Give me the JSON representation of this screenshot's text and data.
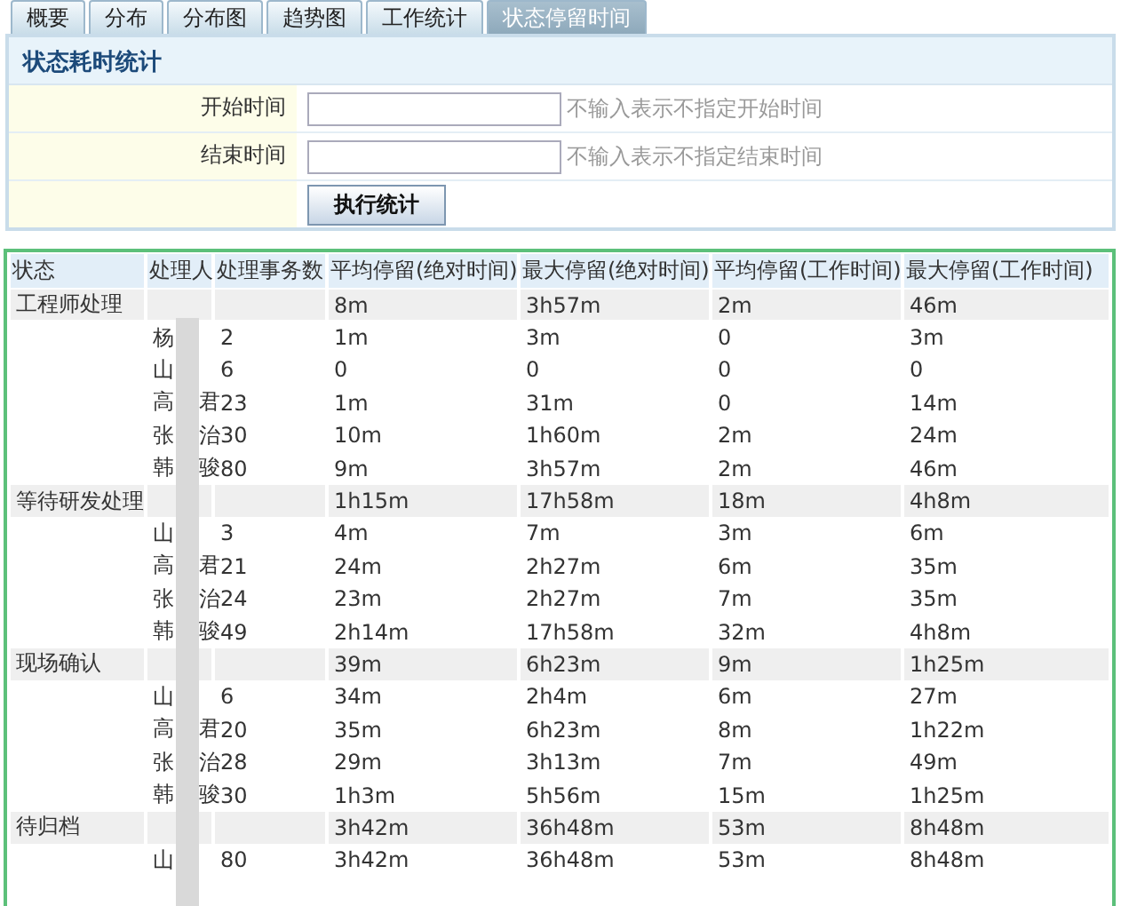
{
  "tabs": [
    {
      "label": "概要",
      "selected": false
    },
    {
      "label": "分布",
      "selected": false
    },
    {
      "label": "分布图",
      "selected": false
    },
    {
      "label": "趋势图",
      "selected": false
    },
    {
      "label": "工作统计",
      "selected": false
    },
    {
      "label": "状态停留时间",
      "selected": true
    }
  ],
  "form": {
    "title": "状态耗时统计",
    "fields": [
      {
        "label": "开始时间",
        "hint": "不输入表示不指定开始时间"
      },
      {
        "label": "结束时间",
        "hint": "不输入表示不指定结束时间"
      }
    ],
    "button": "执行统计"
  },
  "table": {
    "columns": [
      "状态",
      "处理人",
      "处理事务数",
      "平均停留(绝对时间)",
      "最大停留(绝对时间)",
      "平均停留(工作时间)",
      "最大停留(工作时间)"
    ],
    "groups": [
      {
        "status": "工程师处理",
        "values": [
          "8m",
          "3h57m",
          "2m",
          "46m"
        ],
        "handlers": [
          {
            "first": "杨",
            "count": "2",
            "values": [
              "1m",
              "3m",
              "0",
              "3m"
            ]
          },
          {
            "first": "山",
            "count": "6",
            "values": [
              "0",
              "0",
              "0",
              "0"
            ]
          },
          {
            "first": "高",
            "last": "君",
            "count": "23",
            "values": [
              "1m",
              "31m",
              "0",
              "14m"
            ]
          },
          {
            "first": "张",
            "last": "治",
            "count": "30",
            "values": [
              "10m",
              "1h60m",
              "2m",
              "24m"
            ]
          },
          {
            "first": "韩",
            "last": "骏",
            "count": "80",
            "values": [
              "9m",
              "3h57m",
              "2m",
              "46m"
            ]
          }
        ]
      },
      {
        "status": "等待研发处理",
        "values": [
          "1h15m",
          "17h58m",
          "18m",
          "4h8m"
        ],
        "handlers": [
          {
            "first": "山",
            "count": "3",
            "values": [
              "4m",
              "7m",
              "3m",
              "6m"
            ]
          },
          {
            "first": "高",
            "last": "君",
            "count": "21",
            "values": [
              "24m",
              "2h27m",
              "6m",
              "35m"
            ]
          },
          {
            "first": "张",
            "last": "治",
            "count": "24",
            "values": [
              "23m",
              "2h27m",
              "7m",
              "35m"
            ]
          },
          {
            "first": "韩",
            "last": "骏",
            "count": "49",
            "values": [
              "2h14m",
              "17h58m",
              "32m",
              "4h8m"
            ]
          }
        ]
      },
      {
        "status": "现场确认",
        "values": [
          "39m",
          "6h23m",
          "9m",
          "1h25m"
        ],
        "handlers": [
          {
            "first": "山",
            "count": "6",
            "values": [
              "34m",
              "2h4m",
              "6m",
              "27m"
            ]
          },
          {
            "first": "高",
            "last": "君",
            "count": "20",
            "values": [
              "35m",
              "6h23m",
              "8m",
              "1h22m"
            ]
          },
          {
            "first": "张",
            "last": "治",
            "count": "28",
            "values": [
              "29m",
              "3h13m",
              "7m",
              "49m"
            ]
          },
          {
            "first": "韩",
            "last": "骏",
            "count": "30",
            "values": [
              "1h3m",
              "5h56m",
              "15m",
              "1h25m"
            ]
          }
        ]
      },
      {
        "status": "待归档",
        "values": [
          "3h42m",
          "36h48m",
          "53m",
          "8h48m"
        ],
        "handlers": [
          {
            "first": "山",
            "count": "80",
            "values": [
              "3h42m",
              "36h48m",
              "53m",
              "8h48m"
            ]
          }
        ]
      }
    ]
  }
}
